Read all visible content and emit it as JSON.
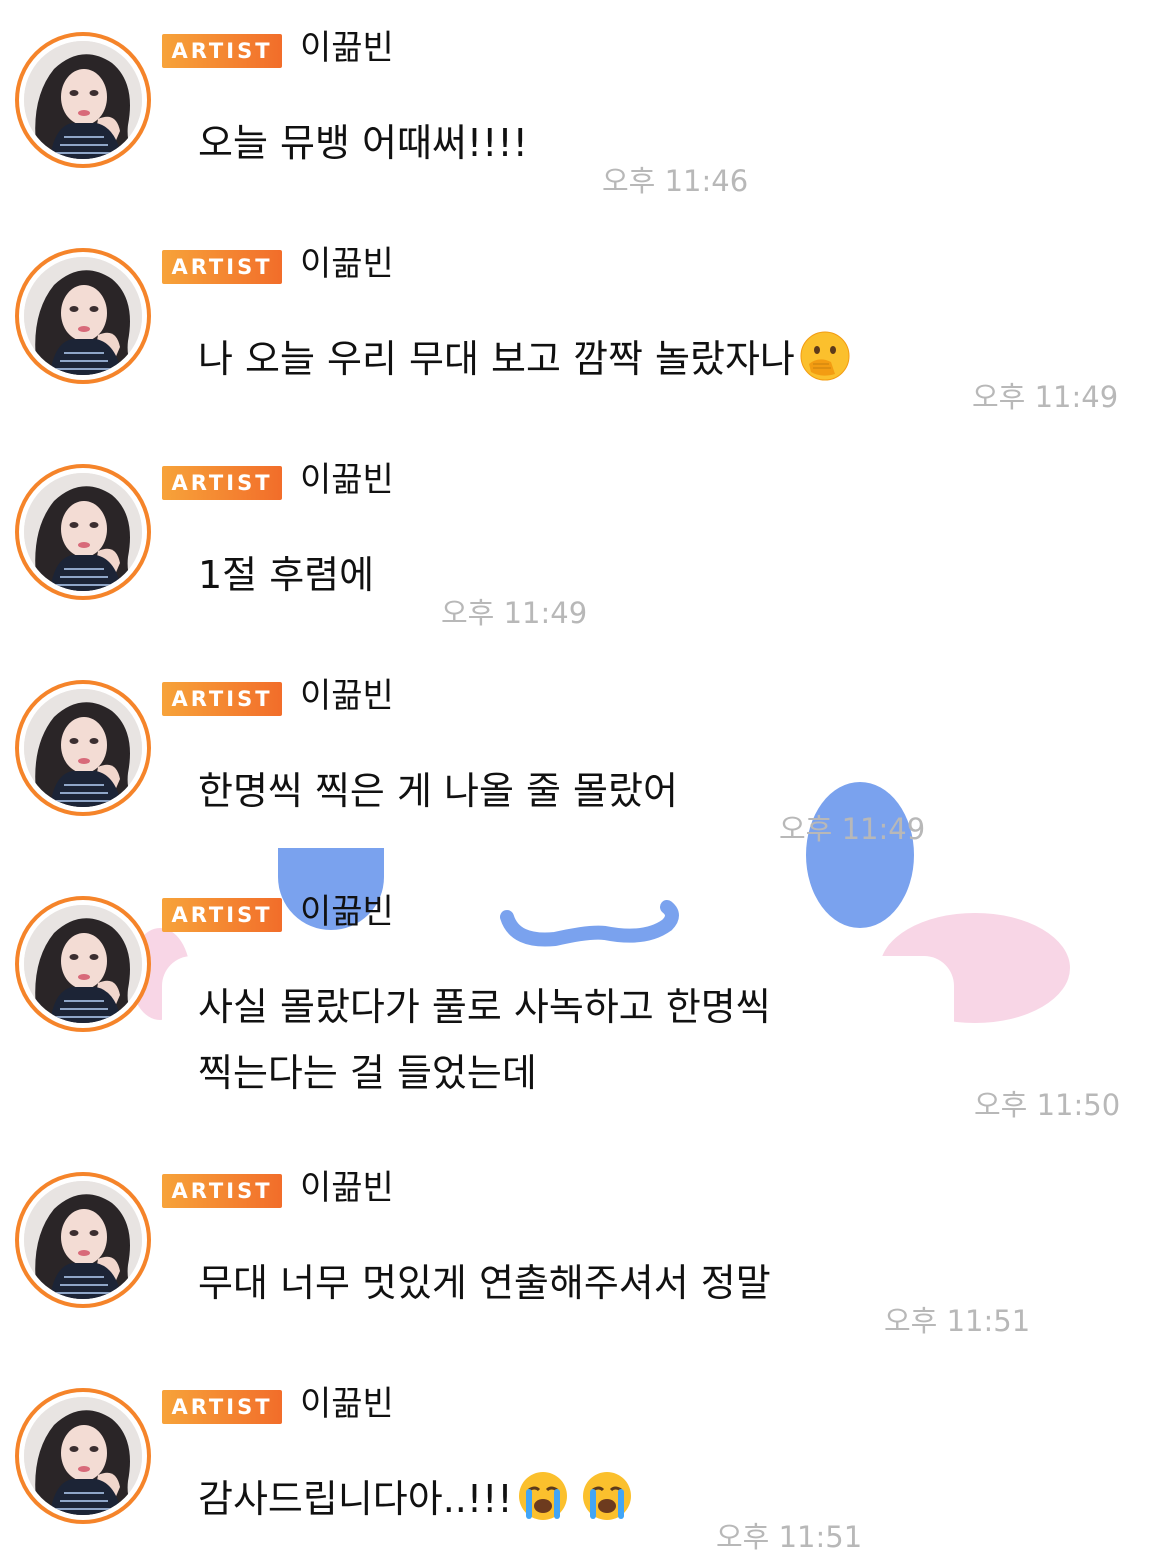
{
  "badge_label": "ARTIST",
  "colors": {
    "accent_orange": "#f5842a",
    "timestamp_gray": "#b8b8b8"
  },
  "messages": [
    {
      "sender": "이끎빈",
      "text": "오늘 뮤뱅 어때써!!!!",
      "time": "오후 11:46"
    },
    {
      "sender": "이끎빈",
      "text": "나 오늘 우리 무대 보고 깜짝 놀랐자나",
      "emoji": [
        "face-with-hand-over-mouth"
      ],
      "time": "오후 11:49"
    },
    {
      "sender": "이끎빈",
      "text": "1절 후렴에",
      "time": "오후 11:49"
    },
    {
      "sender": "이끎빈",
      "text": "한명씩 찍은 게 나올 줄 몰랐어",
      "time": "오후 11:49"
    },
    {
      "sender": "이끎빈",
      "text": "사실 몰랐다가 풀로 사녹하고 한명씩 찍는다는 걸 들었는데",
      "time": "오후 11:50"
    },
    {
      "sender": "이끎빈",
      "text": "무대 너무 멋있게 연출해주셔서 정말",
      "time": "오후 11:51"
    },
    {
      "sender": "이끎빈",
      "text": "감사드립니다아..!!!",
      "emoji": [
        "loudly-crying-face",
        "loudly-crying-face"
      ],
      "time": "오후 11:51"
    }
  ]
}
